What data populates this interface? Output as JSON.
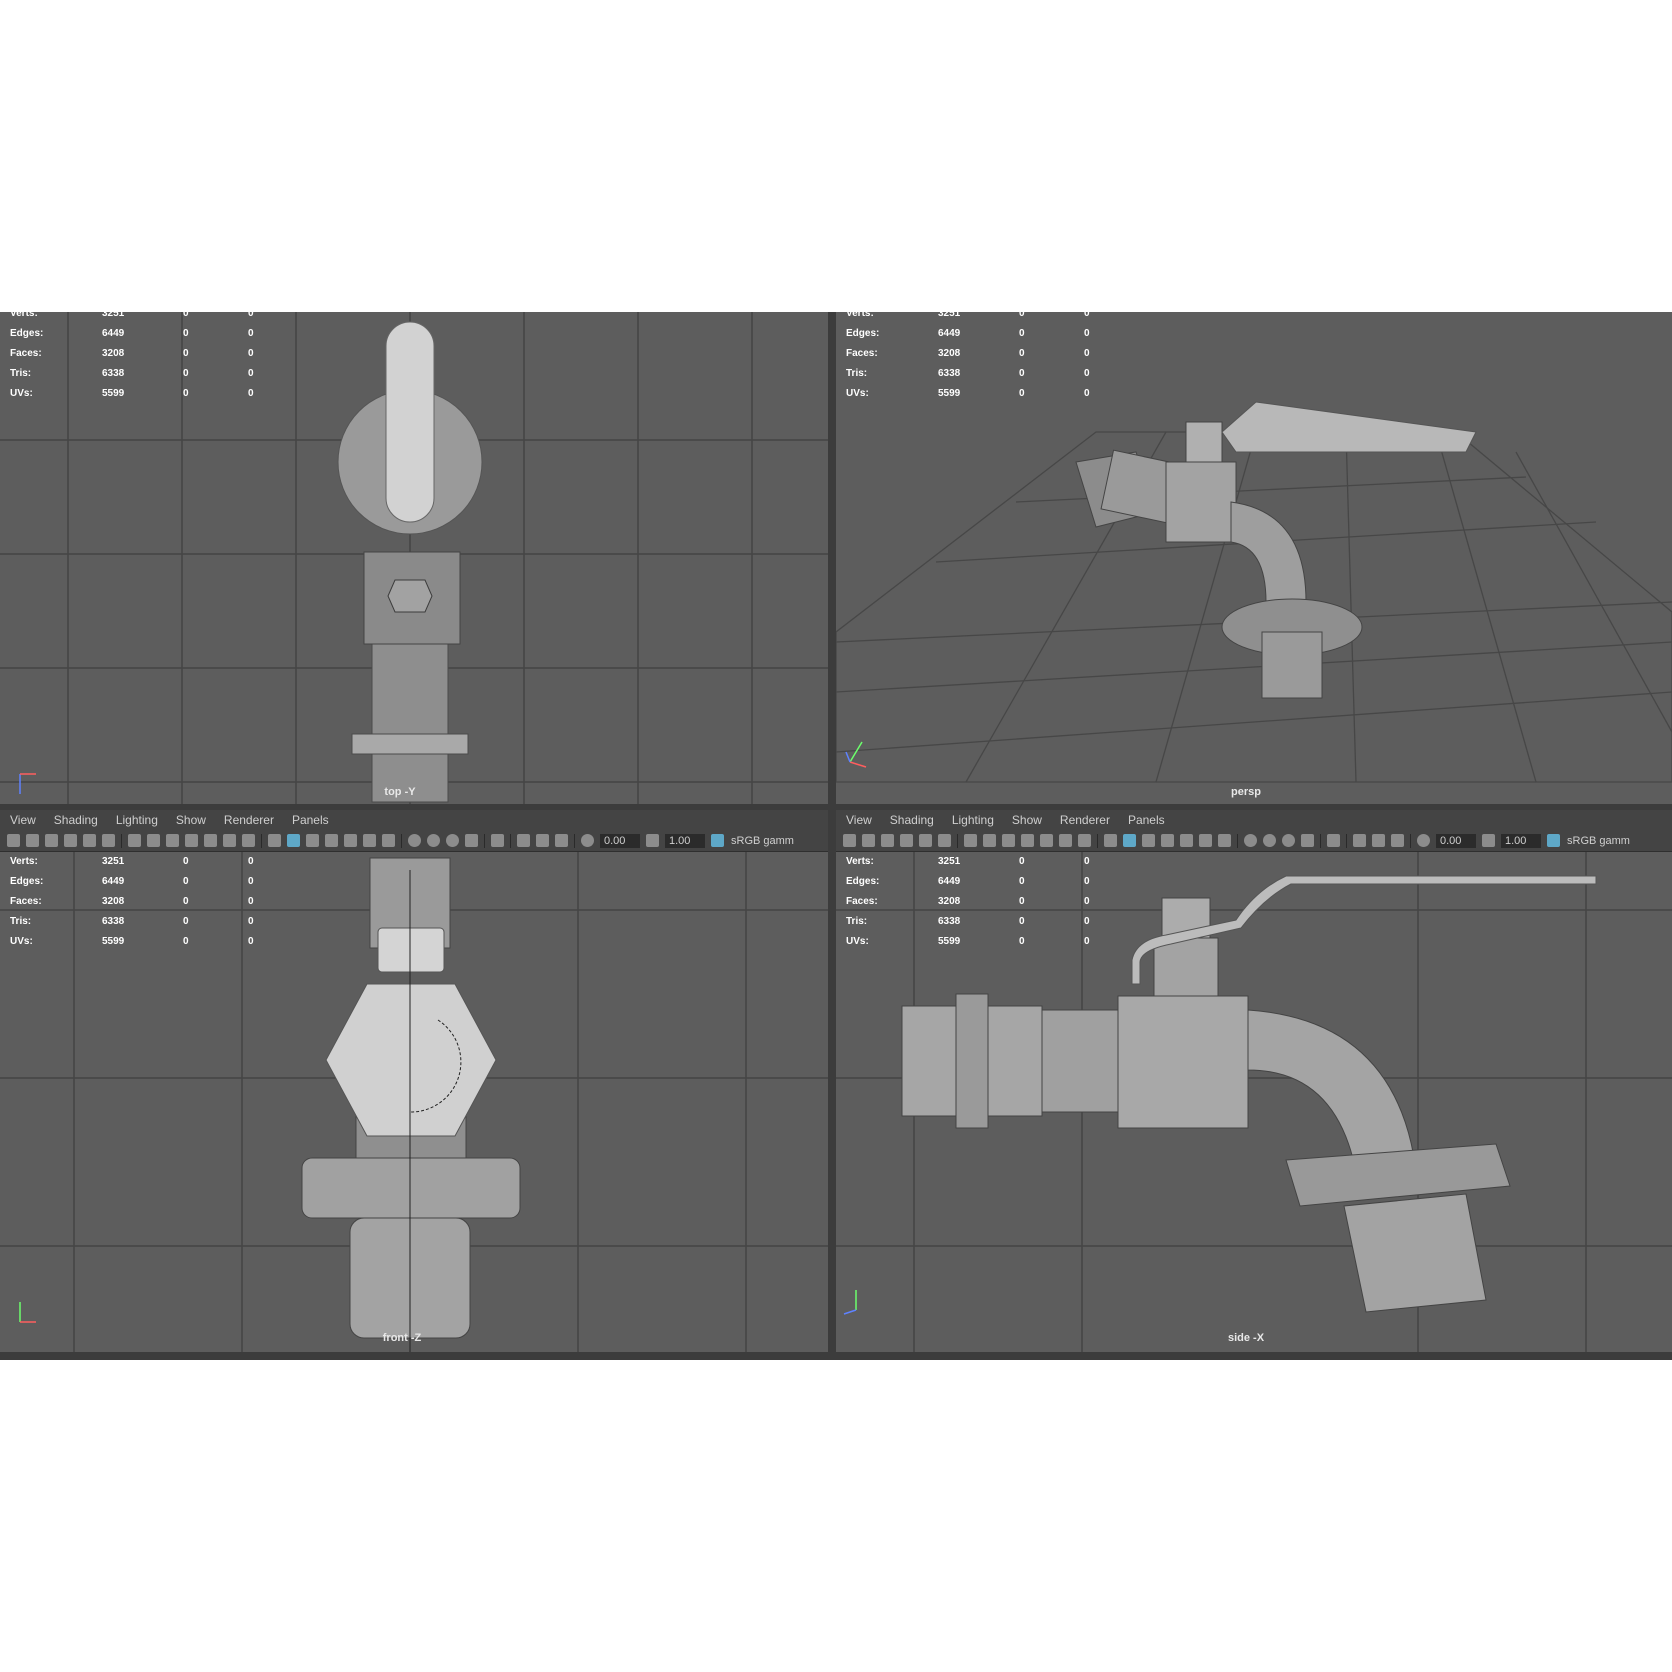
{
  "stats_labels": [
    "Verts:",
    "Edges:",
    "Faces:",
    "Tris:",
    "UVs:"
  ],
  "stats_values": [
    [
      "3251",
      "0",
      "0"
    ],
    [
      "6449",
      "0",
      "0"
    ],
    [
      "3208",
      "0",
      "0"
    ],
    [
      "6338",
      "0",
      "0"
    ],
    [
      "5599",
      "0",
      "0"
    ]
  ],
  "menu": [
    "View",
    "Shading",
    "Lighting",
    "Show",
    "Renderer",
    "Panels"
  ],
  "toolbar": {
    "field1": "0.00",
    "field2": "1.00",
    "color_space": "sRGB gamm"
  },
  "viewports": {
    "top": {
      "camera": "top -Y"
    },
    "persp": {
      "camera": "persp"
    },
    "front": {
      "camera": "front -Z"
    },
    "side": {
      "camera": "side -X"
    }
  },
  "icons": [
    "camera-icon",
    "grid-icon",
    "shaded-icon",
    "light-icon",
    "isolate-icon",
    "exposure-icon",
    "gamma-icon",
    "color-space-icon"
  ],
  "colors": {
    "viewport_bg": "#5d5d5d",
    "grid_line": "#444444",
    "model": "#9a9a9a",
    "highlight": "#5ea8c8"
  }
}
